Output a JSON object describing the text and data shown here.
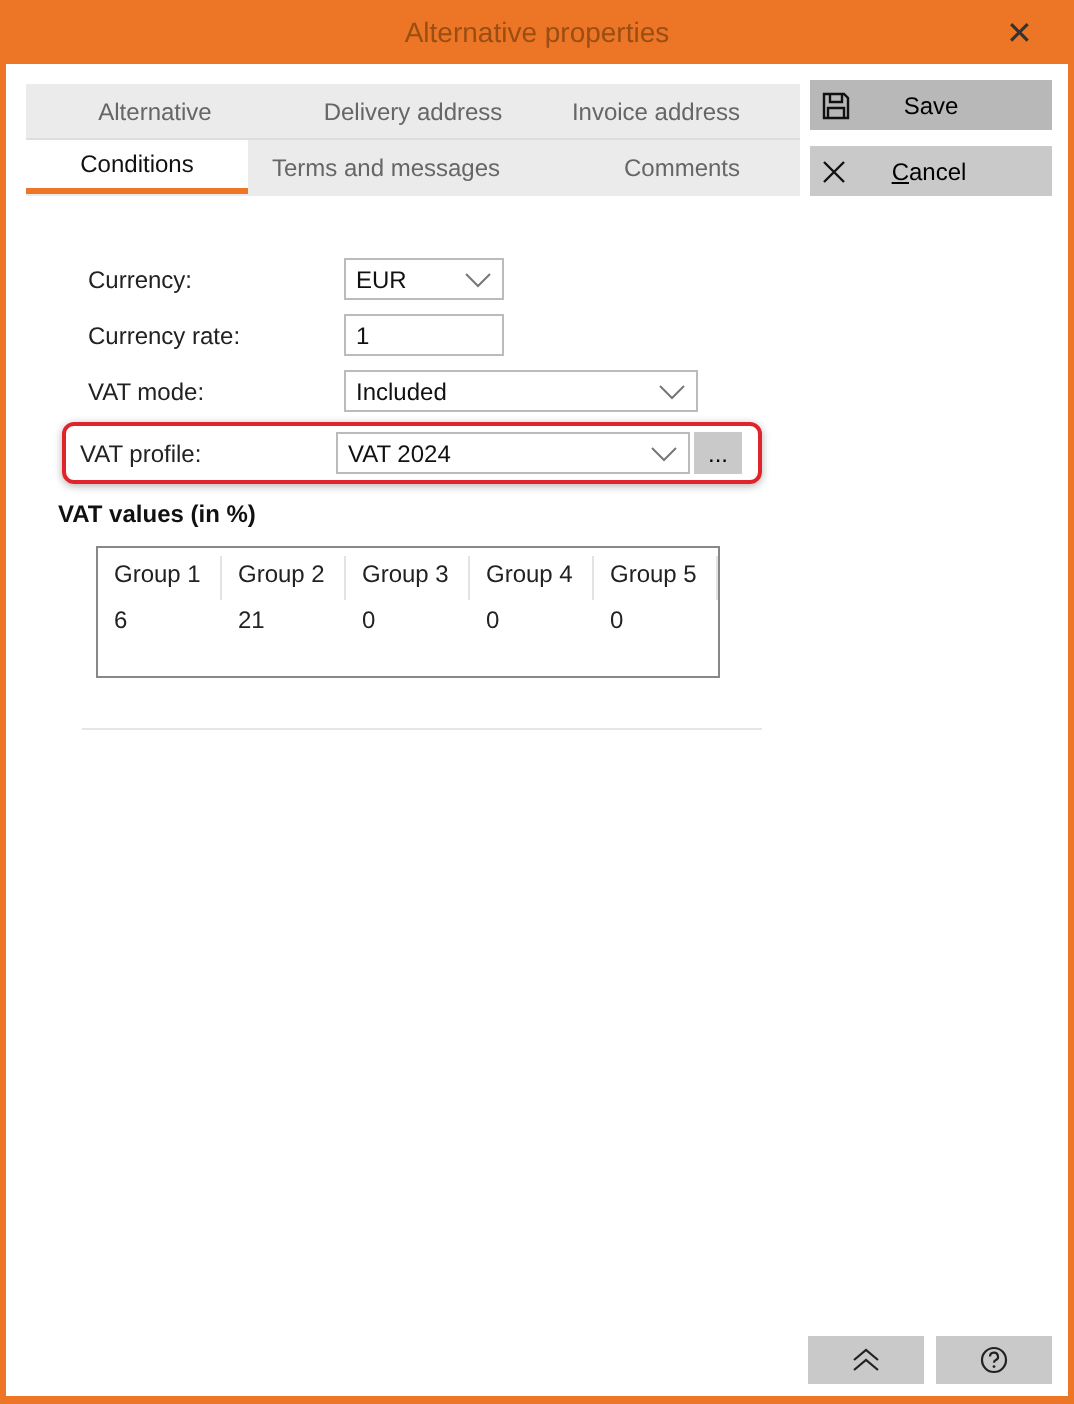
{
  "window": {
    "title": "Alternative properties",
    "close": "✕"
  },
  "tabs": [
    [
      {
        "label": "Alternative",
        "selected": false
      },
      {
        "label": "Delivery address",
        "selected": false
      },
      {
        "label": "Invoice address",
        "selected": false
      }
    ],
    [
      {
        "label": "Conditions",
        "selected": true
      },
      {
        "label": "Terms and messages",
        "selected": false
      },
      {
        "label": "Comments",
        "selected": false
      }
    ]
  ],
  "actions": [
    {
      "label": "Save",
      "kind": "save"
    },
    {
      "label": "Cancel",
      "kind": "cancel"
    }
  ],
  "fields": [
    {
      "label": "Currency:",
      "kind": "select",
      "value": "EUR",
      "wide": false,
      "highlighted": false
    },
    {
      "label": "Currency rate:",
      "kind": "text",
      "value": "1",
      "wide": false,
      "highlighted": false
    },
    {
      "label": "VAT mode:",
      "kind": "select",
      "value": "Included",
      "wide": true,
      "highlighted": false
    },
    {
      "label": "VAT profile:",
      "kind": "select",
      "value": "VAT 2024",
      "wide": true,
      "highlighted": true,
      "browse": "..."
    }
  ],
  "vat": {
    "title": "VAT values (in %)",
    "columns": [
      "Group 1",
      "Group 2",
      "Group 3",
      "Group 4",
      "Group 5"
    ],
    "values": [
      "6",
      "21",
      "0",
      "0",
      "0"
    ]
  },
  "footer": [
    {
      "kind": "up"
    },
    {
      "kind": "help"
    }
  ]
}
